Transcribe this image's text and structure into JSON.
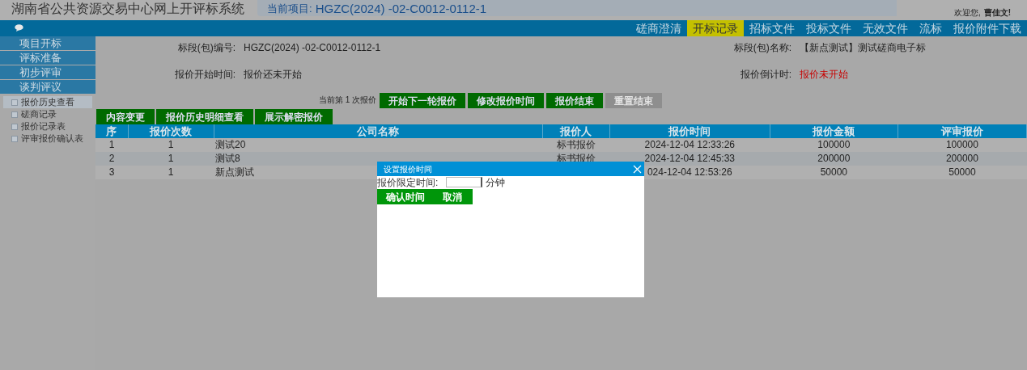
{
  "header": {
    "system_title": "湖南省公共资源交易中心网上开评标系统",
    "current_project_label": "当前项目:",
    "current_project": "HGZC(2024) -02-C0012-0112-1",
    "welcome": "欢迎您,",
    "user": "曹佳文!"
  },
  "nav_tabs": [
    {
      "label": "磋商澄清",
      "selected": false
    },
    {
      "label": "开标记录",
      "selected": true
    },
    {
      "label": "招标文件",
      "selected": false
    },
    {
      "label": "投标文件",
      "selected": false
    },
    {
      "label": "无效文件",
      "selected": false
    },
    {
      "label": "流标",
      "selected": false
    },
    {
      "label": "报价附件下载",
      "selected": false
    }
  ],
  "sidebar": {
    "sections": [
      "项目开标",
      "评标准备",
      "初步评审",
      "谈判评议"
    ],
    "items": [
      {
        "label": "报价历史查看",
        "selected": true
      },
      {
        "label": "磋商记录",
        "selected": false
      },
      {
        "label": "报价记录表",
        "selected": false
      },
      {
        "label": "评审报价确认表",
        "selected": false
      }
    ]
  },
  "info": {
    "fields": [
      {
        "label": "标段(包)编号:",
        "value": "HGZC(2024) -02-C0012-0112-1",
        "kind": "normal"
      },
      {
        "label": "标段(包)名称:",
        "value": "【新点测试】测试磋商电子标",
        "kind": "normal"
      },
      {
        "label": "报价开始时间:",
        "value": "报价还未开始",
        "kind": "normal"
      },
      {
        "label": "报价倒计时:",
        "value": "报价未开始",
        "kind": "alert"
      }
    ]
  },
  "round_note": "当前第 1 次报价",
  "round_buttons": [
    {
      "label": "开始下一轮报价",
      "disabled": false
    },
    {
      "label": "修改报价时间",
      "disabled": false
    },
    {
      "label": "报价结束",
      "disabled": false
    },
    {
      "label": "重置结束",
      "disabled": true
    }
  ],
  "toolbar": [
    "内容变更",
    "报价历史明细查看",
    "展示解密报价"
  ],
  "table": {
    "columns": [
      "序",
      "报价次数",
      "公司名称",
      "报价人",
      "报价时间",
      "报价金额",
      "评审报价"
    ],
    "rows": [
      [
        "1",
        "1",
        "测试20",
        "标书报价",
        "2024-12-04 12:33:26",
        "100000",
        "100000"
      ],
      [
        "2",
        "1",
        "测试8",
        "标书报价",
        "2024-12-04 12:45:33",
        "200000",
        "200000"
      ],
      [
        "3",
        "1",
        "新点测试",
        "",
        "024-12-04 12:53:26",
        "50000",
        "50000"
      ]
    ]
  },
  "dialog": {
    "title": "设置报价时间",
    "field_label": "报价限定时间:",
    "unit": "分钟",
    "buttons": [
      "确认时间",
      "取消"
    ]
  }
}
